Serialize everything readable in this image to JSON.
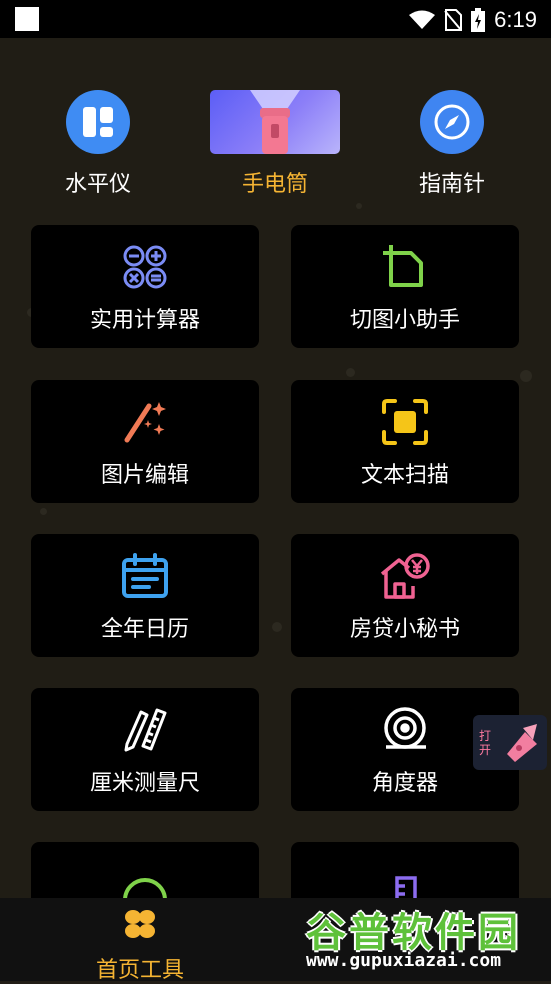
{
  "status_bar": {
    "time": "6:19"
  },
  "top_tools": [
    {
      "label": "水平仪",
      "icon": "level-icon"
    },
    {
      "label": "手电筒",
      "icon": "flashlight-banner"
    },
    {
      "label": "指南针",
      "icon": "compass-icon"
    }
  ],
  "cards": [
    {
      "label": "实用计算器",
      "icon": "calculator-icon"
    },
    {
      "label": "切图小助手",
      "icon": "crop-icon"
    },
    {
      "label": "图片编辑",
      "icon": "magic-wand-icon"
    },
    {
      "label": "文本扫描",
      "icon": "scan-icon"
    },
    {
      "label": "全年日历",
      "icon": "calendar-icon"
    },
    {
      "label": "房贷小秘书",
      "icon": "house-yen-icon"
    },
    {
      "label": "厘米测量尺",
      "icon": "ruler-pencil-icon"
    },
    {
      "label": "角度器",
      "icon": "tape-measure-icon"
    }
  ],
  "floating": {
    "open_label": "打开"
  },
  "bottom_nav": {
    "home_label": "首页工具"
  },
  "watermark": {
    "text": "谷普软件园",
    "url": "www.gupuxiazai.com"
  },
  "colors": {
    "accent": "#f5b433",
    "card_bg": "#000000",
    "page_bg": "#201d15"
  }
}
